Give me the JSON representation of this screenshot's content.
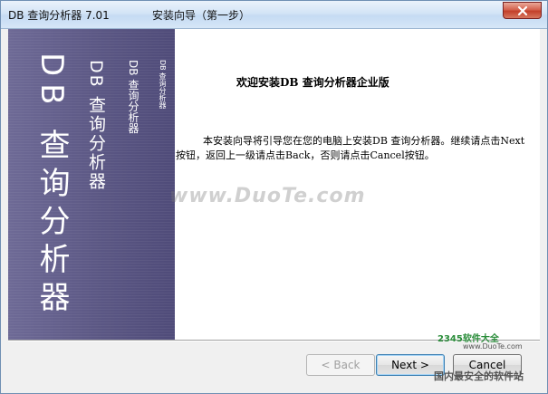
{
  "titlebar": {
    "app_title": "DB 查询分析器 7.01",
    "step_title": "安装向导（第一步）"
  },
  "banner": {
    "big_text": "DB 查询分析器",
    "mid_text": "DB 查询分析器",
    "small_text": "DB 查询分析器",
    "tiny_text": "DB 查询分析器"
  },
  "main": {
    "welcome": "欢迎安装DB 查询分析器企业版",
    "description": "本安装向导将引导您在您的电脑上安装DB 查询分析器。继续请点击Next按钮，返回上一级请点击Back，否则请点击Cancel按钮。"
  },
  "watermark": {
    "text": "www.DuoTe.com"
  },
  "buttons": {
    "back": "< Back",
    "next": "Next >",
    "cancel": "Cancel"
  },
  "site_logo": {
    "name": "2345软件大全",
    "url": "www.DuoTe.com",
    "slogan": "国内最安全的软件站"
  },
  "colors": {
    "banner_bg": "#5b5784",
    "close_red": "#c3402a",
    "titlebar": "#d3e4f6"
  }
}
